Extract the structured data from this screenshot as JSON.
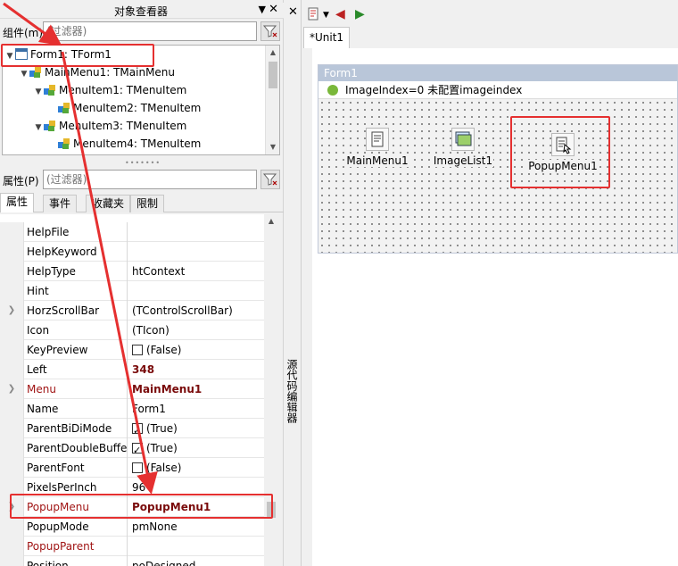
{
  "inspector": {
    "title": "对象查看器",
    "pin_icon": "pin-icon",
    "components_label": "组件(m)",
    "filter_placeholder": "(过滤器)",
    "properties_label": "属性(P)",
    "tree": [
      {
        "label": "Form1: TForm1",
        "icon": "form-icon"
      },
      {
        "label": "MainMenu1: TMainMenu",
        "icon": "component-icon"
      },
      {
        "label": "MenuItem1: TMenuItem",
        "icon": "component-icon"
      },
      {
        "label": "MenuItem2: TMenuItem",
        "icon": "component-icon"
      },
      {
        "label": "MenuItem3: TMenuItem",
        "icon": "component-icon"
      },
      {
        "label": "MenuItem4: TMenuItem",
        "icon": "component-icon"
      }
    ],
    "tabs": [
      "属性",
      "事件",
      "收藏夹",
      "限制"
    ],
    "properties": [
      {
        "name": "HelpFile",
        "value": ""
      },
      {
        "name": "HelpKeyword",
        "value": ""
      },
      {
        "name": "HelpType",
        "value": "htContext"
      },
      {
        "name": "Hint",
        "value": ""
      },
      {
        "name": "HorzScrollBar",
        "value": "(TControlScrollBar)"
      },
      {
        "name": "Icon",
        "value": "(TIcon)"
      },
      {
        "name": "KeyPreview",
        "value": "(False)"
      },
      {
        "name": "Left",
        "value": "348"
      },
      {
        "name": "Menu",
        "value": "MainMenu1"
      },
      {
        "name": "Name",
        "value": "Form1"
      },
      {
        "name": "ParentBiDiMode",
        "value": "(True)"
      },
      {
        "name": "ParentDoubleBuffered",
        "value": "(True)"
      },
      {
        "name": "ParentFont",
        "value": "(False)"
      },
      {
        "name": "PixelsPerInch",
        "value": "96"
      },
      {
        "name": "PopupMenu",
        "value": "PopupMenu1"
      },
      {
        "name": "PopupMode",
        "value": "pmNone"
      },
      {
        "name": "PopupParent",
        "value": ""
      },
      {
        "name": "Position",
        "value": "poDesigned"
      }
    ]
  },
  "side_strip": {
    "label": "源代码编辑器"
  },
  "designer": {
    "tab": "*Unit1",
    "form_caption": "Form1",
    "status_text": "ImageIndex=0    未配置imageindex",
    "components": [
      {
        "label": "MainMenu1",
        "icon": "main-menu-icon"
      },
      {
        "label": "ImageList1",
        "icon": "image-list-icon"
      },
      {
        "label": "PopupMenu1",
        "icon": "popup-menu-icon"
      }
    ],
    "colors": {
      "highlight": "#e53030",
      "caption": "#b9c6d9",
      "accent_red": "#a01414"
    }
  }
}
